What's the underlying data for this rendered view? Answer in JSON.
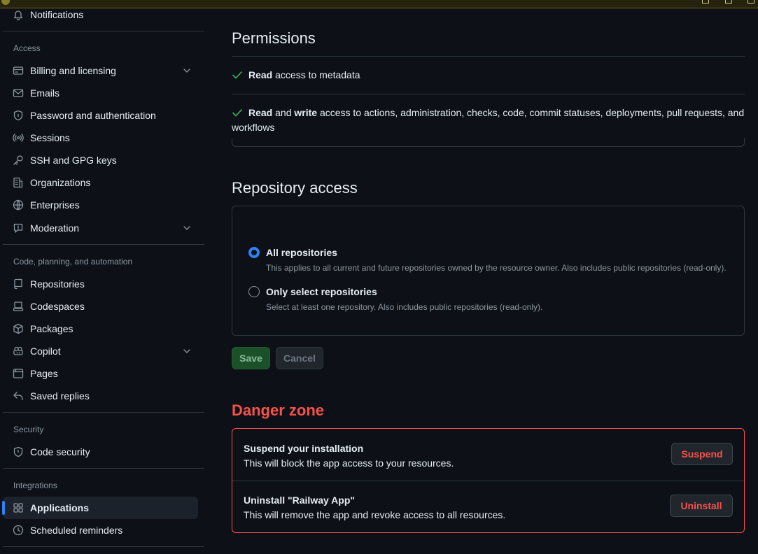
{
  "sidebar": {
    "top_item": "Notifications",
    "sections": {
      "access": "Access",
      "code": "Code, planning, and automation",
      "security": "Security",
      "integrations": "Integrations"
    },
    "items": {
      "billing": "Billing and licensing",
      "emails": "Emails",
      "password": "Password and authentication",
      "sessions": "Sessions",
      "ssh": "SSH and GPG keys",
      "organizations": "Organizations",
      "enterprises": "Enterprises",
      "moderation": "Moderation",
      "repositories": "Repositories",
      "codespaces": "Codespaces",
      "packages": "Packages",
      "copilot": "Copilot",
      "pages": "Pages",
      "saved_replies": "Saved replies",
      "code_security": "Code security",
      "applications": "Applications",
      "scheduled_reminders": "Scheduled reminders"
    },
    "active_item": "Applications"
  },
  "permissions": {
    "title": "Permissions",
    "p1": {
      "bold": "Read",
      "rest": " access to metadata"
    },
    "p2": {
      "bold1": "Read",
      "mid": " and ",
      "bold2": "write",
      "rest": " access to actions, administration, checks, code, commit statuses, deployments, pull requests, and workflows"
    }
  },
  "repo_access": {
    "title": "Repository access",
    "all_label": "All repositories",
    "all_desc": "This applies to all current and future repositories owned by the resource owner. Also includes public repositories (read-only).",
    "select_label": "Only select repositories",
    "select_desc": "Select at least one repository. Also includes public repositories (read-only).",
    "selected": "All repositories",
    "save": "Save",
    "cancel": "Cancel"
  },
  "danger": {
    "title": "Danger zone",
    "suspend_title": "Suspend your installation",
    "suspend_desc": "This will block the app access to your resources.",
    "suspend_btn": "Suspend",
    "uninstall_title": "Uninstall \"Railway App\"",
    "uninstall_desc": "This will remove the app and revoke access to all resources.",
    "uninstall_btn": "Uninstall"
  },
  "colors": {
    "background": "#0d1117",
    "accent": "#2f81f7",
    "success": "#3fb950",
    "danger": "#f85149",
    "muted": "#8d96a0"
  }
}
